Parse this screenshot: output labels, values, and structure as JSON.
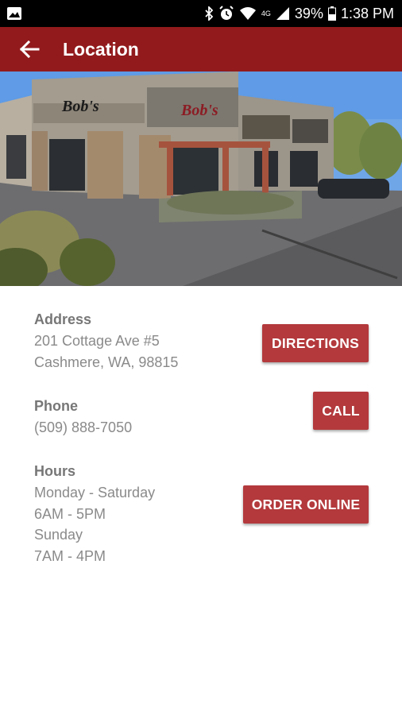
{
  "status_bar": {
    "battery": "39%",
    "time": "1:38 PM",
    "network": "4G",
    "icons": [
      "image-icon",
      "bluetooth-icon",
      "alarm-icon",
      "wifi-icon",
      "signal-icon",
      "battery-icon"
    ]
  },
  "app_bar": {
    "title": "Location",
    "back_icon": "arrow-left-icon",
    "color": "#921a1c"
  },
  "hero_image": {
    "signs": [
      "Bob's",
      "Bob's"
    ]
  },
  "address": {
    "label": "Address",
    "line1": "201 Cottage Ave #5",
    "line2": "Cashmere, WA, 98815",
    "button": "DIRECTIONS"
  },
  "phone": {
    "label": "Phone",
    "number": "(509) 888-7050",
    "button": "CALL"
  },
  "hours": {
    "label": "Hours",
    "line1": "Monday - Saturday",
    "line2": "6AM - 5PM",
    "line3": "Sunday",
    "line4": "7AM - 4PM",
    "button": "ORDER ONLINE"
  },
  "colors": {
    "button_bg": "#b3393c",
    "label": "#777777",
    "text": "#8a8a8a"
  }
}
